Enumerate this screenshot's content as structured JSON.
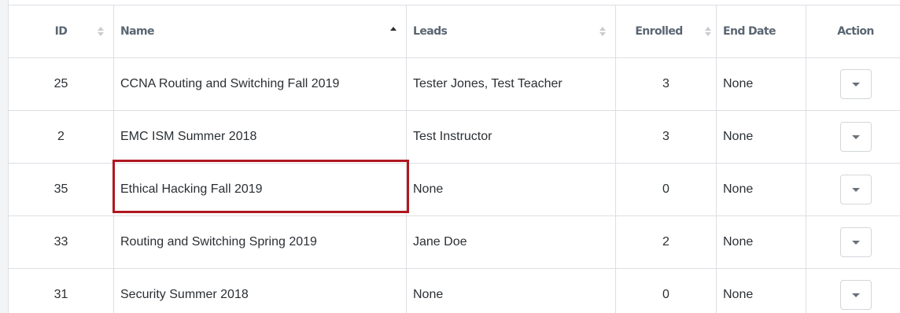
{
  "table": {
    "columns": [
      {
        "key": "id",
        "label": "ID",
        "sort": "none"
      },
      {
        "key": "name",
        "label": "Name",
        "sort": "asc"
      },
      {
        "key": "leads",
        "label": "Leads",
        "sort": "none"
      },
      {
        "key": "enrolled",
        "label": "Enrolled",
        "sort": "none"
      },
      {
        "key": "end_date",
        "label": "End Date"
      },
      {
        "key": "action",
        "label": "Action"
      }
    ],
    "rows": [
      {
        "id": "25",
        "name": "CCNA Routing and Switching Fall 2019",
        "leads": "Tester Jones, Test Teacher",
        "enrolled": "3",
        "end_date": "None",
        "action_icon": "caret-down-icon"
      },
      {
        "id": "2",
        "name": "EMC ISM Summer 2018",
        "leads": "Test Instructor",
        "enrolled": "3",
        "end_date": "None",
        "action_icon": "caret-down-icon"
      },
      {
        "id": "35",
        "name": "Ethical Hacking Fall 2019",
        "leads": "None",
        "enrolled": "0",
        "end_date": "None",
        "action_icon": "caret-down-icon"
      },
      {
        "id": "33",
        "name": "Routing and Switching Spring 2019",
        "leads": "Jane Doe",
        "enrolled": "2",
        "end_date": "None",
        "action_icon": "caret-down-icon"
      },
      {
        "id": "31",
        "name": "Security Summer 2018",
        "leads": "None",
        "enrolled": "0",
        "end_date": "None",
        "action_icon": "caret-down-icon"
      }
    ]
  },
  "highlight": {
    "row_index": 2,
    "column": "name",
    "color": "#b0171f"
  },
  "colors": {
    "border": "#dcdfe3",
    "header_text": "#5a6672",
    "body_text": "#2b2f33"
  }
}
